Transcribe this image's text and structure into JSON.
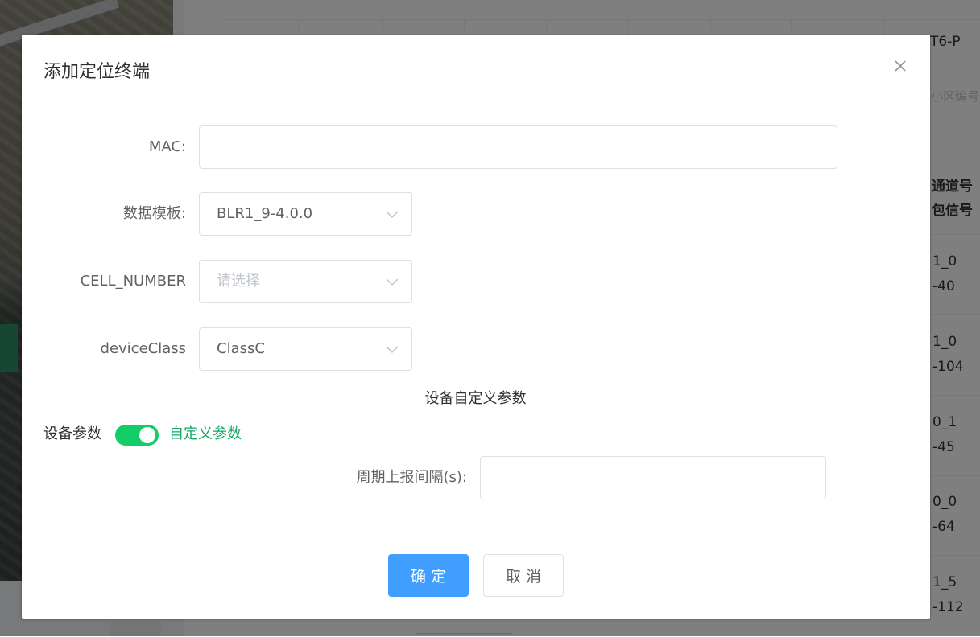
{
  "background": {
    "table_header_partial": "T6-P",
    "search_placeholder_partial": "小区编号",
    "column_header_line1": "通道号",
    "column_header_line2": "包信号",
    "rows": [
      {
        "line1": "1_0",
        "line2": "-40"
      },
      {
        "line1": "1_0",
        "line2": "-104"
      },
      {
        "line1": "0_1",
        "line2": "-45"
      },
      {
        "line1": "0_0",
        "line2": "-64"
      },
      {
        "line1": "1_5",
        "line2": "-112"
      }
    ]
  },
  "dialog": {
    "title": "添加定位终端",
    "close_icon": "close-icon",
    "fields": {
      "mac": {
        "label": "MAC:",
        "value": "",
        "placeholder": ""
      },
      "data_template": {
        "label": "数据模板:",
        "value": "BLR1_9-4.0.0"
      },
      "cell_number": {
        "label": "CELL_NUMBER",
        "value": "",
        "placeholder": "请选择"
      },
      "device_class": {
        "label": "deviceClass",
        "value": "ClassC"
      }
    },
    "divider_text": "设备自定义参数",
    "device_params": {
      "label": "设备参数",
      "switch_on": true,
      "switch_text": "自定义参数"
    },
    "period": {
      "label": "周期上报间隔(s):",
      "value": "",
      "placeholder": ""
    },
    "buttons": {
      "confirm": "确定",
      "cancel": "取消"
    },
    "colors": {
      "primary": "#409eff",
      "switch_on": "#13ce66",
      "switch_text": "#13a868"
    }
  }
}
